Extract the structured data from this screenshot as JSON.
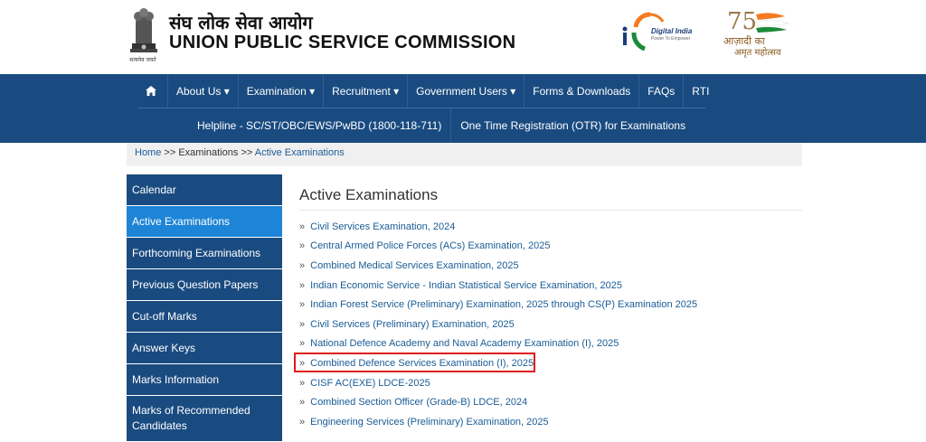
{
  "header": {
    "motto": "सत्यमेव जयते",
    "title_hindi": "संघ लोक सेवा आयोग",
    "title_english": "UNION PUBLIC SERVICE COMMISSION",
    "digital_india": "Digital India",
    "digital_india_tagline": "Power To Empower",
    "azadi_line1": "आज़ादी का",
    "azadi_line2": "अमृत महोत्सव",
    "azadi_number": "75"
  },
  "nav": {
    "home_icon": "home-icon",
    "row1": [
      {
        "label": "About Us ▾",
        "name": "nav-about-us"
      },
      {
        "label": "Examination ▾",
        "name": "nav-examination"
      },
      {
        "label": "Recruitment ▾",
        "name": "nav-recruitment"
      },
      {
        "label": "Government Users ▾",
        "name": "nav-government-users"
      },
      {
        "label": "Forms & Downloads",
        "name": "nav-forms-downloads"
      },
      {
        "label": "FAQs",
        "name": "nav-faqs"
      },
      {
        "label": "RTI",
        "name": "nav-rti"
      }
    ],
    "row2": [
      {
        "label": "Helpline - SC/ST/OBC/EWS/PwBD (1800-118-711)",
        "name": "nav-helpline"
      },
      {
        "label": "One Time Registration (OTR) for Examinations",
        "name": "nav-otr"
      }
    ]
  },
  "breadcrumb": {
    "home": "Home",
    "sep": ">>",
    "examinations": "Examinations",
    "current": "Active Examinations"
  },
  "sidebar": {
    "items": [
      {
        "label": "Calendar",
        "active": false
      },
      {
        "label": "Active Examinations",
        "active": true
      },
      {
        "label": "Forthcoming Examinations",
        "active": false
      },
      {
        "label": "Previous Question Papers",
        "active": false
      },
      {
        "label": "Cut-off Marks",
        "active": false
      },
      {
        "label": "Answer Keys",
        "active": false
      },
      {
        "label": "Marks Information",
        "active": false
      },
      {
        "label": "Marks of Recommended Candidates",
        "active": false
      }
    ]
  },
  "main": {
    "title": "Active Examinations",
    "bullet": "»",
    "exams": [
      "Civil Services Examination, 2024",
      "Central Armed Police Forces (ACs) Examination, 2025",
      "Combined Medical Services Examination, 2025",
      "Indian Economic Service - Indian Statistical Service Examination, 2025",
      "Indian Forest Service (Preliminary) Examination, 2025 through CS(P) Examination 2025",
      "Civil Services (Preliminary) Examination, 2025",
      "National Defence Academy and Naval Academy Examination (I), 2025",
      "Combined Defence Services Examination (I), 2025",
      "CISF AC(EXE) LDCE-2025",
      "Combined Section Officer (Grade-B) LDCE, 2024",
      "Engineering Services (Preliminary) Examination, 2025"
    ]
  },
  "colors": {
    "nav_bg": "#1a4b80",
    "sidebar_active": "#1e85d6",
    "link": "#1a5c96",
    "highlight": "#e01a1a"
  }
}
